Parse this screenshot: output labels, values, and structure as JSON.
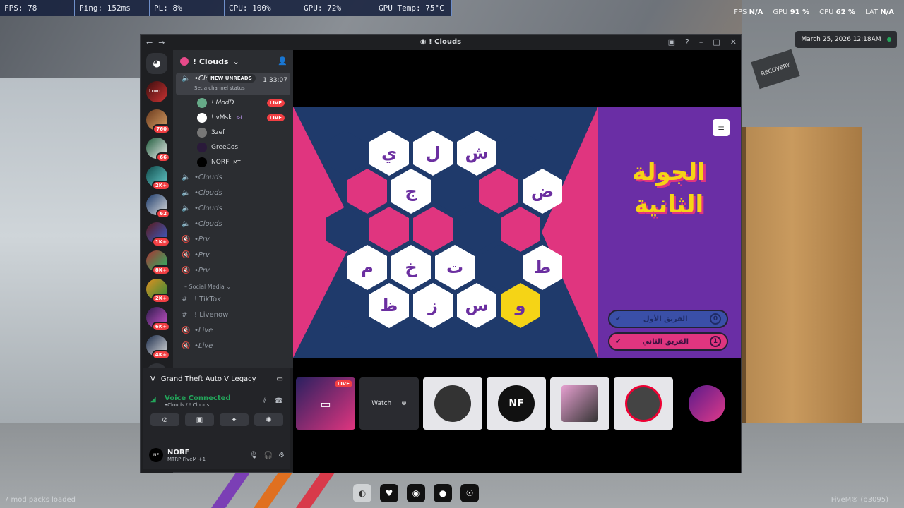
{
  "perf": [
    "FPS: 78",
    "Ping: 152ms",
    "PL: 8%",
    "CPU: 100%",
    "GPU: 72%",
    "GPU Temp: 75°C"
  ],
  "overlay_stats": [
    {
      "label": "FPS",
      "value": "N/A"
    },
    {
      "label": "GPU",
      "value": "91 %"
    },
    {
      "label": "CPU",
      "value": "62 %"
    },
    {
      "label": "LAT",
      "value": "N/A"
    }
  ],
  "clock": "March 25, 2026 12:18AM",
  "bg_sign": "RECOVERY",
  "bottom_left": "7 mod packs loaded",
  "bottom_right": "FiveM® (b3095)",
  "window": {
    "title": "! Clouds"
  },
  "guilds": [
    {
      "label": "Loxo",
      "badge": ""
    },
    {
      "label": "",
      "badge": "760"
    },
    {
      "label": "",
      "badge": "66"
    },
    {
      "label": "",
      "badge": "2K+"
    },
    {
      "label": "",
      "badge": "62"
    },
    {
      "label": "",
      "badge": "1K+"
    },
    {
      "label": "",
      "badge": "8K+"
    },
    {
      "label": "",
      "badge": "2K+"
    },
    {
      "label": "",
      "badge": "6K+"
    },
    {
      "label": "",
      "badge": "4K+"
    }
  ],
  "server": {
    "name": "! Clouds"
  },
  "active_channel": {
    "name": "•Clouds",
    "status": "Set a channel status",
    "time": "1:33:07",
    "unreads": "NEW UNREADS"
  },
  "voice_users": [
    {
      "name": "! ModD",
      "live": "LIVE"
    },
    {
      "name": "! vMsk",
      "tag": "s-i",
      "live": "LIVE"
    },
    {
      "name": "3zef",
      "live": ""
    },
    {
      "name": "GreeCos",
      "live": ""
    },
    {
      "name": "NORF",
      "tag": "MT",
      "live": ""
    }
  ],
  "channels": [
    "•Clouds",
    "•Clouds",
    "•Clouds",
    "•Clouds",
    "•Prv",
    "•Prv",
    "•Prv"
  ],
  "category": "Social Media",
  "text_channels": [
    "! TikTok",
    "! Livenow"
  ],
  "more_channels": [
    "•Live",
    "•Live"
  ],
  "game_activity": "Grand Theft Auto V Legacy",
  "voice": {
    "status": "Voice Connected",
    "location": "•Clouds / ! Clouds"
  },
  "me": {
    "name": "NORF",
    "status": "MTRP FiveM +1"
  },
  "board": {
    "round_title": "الجولة الثانية",
    "team_one": {
      "name": "الفريق الأول",
      "score": "0"
    },
    "team_two": {
      "name": "الفريق الثاني",
      "score": "1"
    }
  },
  "hexes": [
    {
      "l": "",
      "c": "navy"
    },
    {
      "l": "ي",
      "c": "white"
    },
    {
      "l": "ل",
      "c": "white"
    },
    {
      "l": "ش",
      "c": "white"
    },
    {
      "l": "",
      "c": "navy"
    },
    {
      "l": "",
      "c": "pink"
    },
    {
      "l": "ج",
      "c": "white"
    },
    {
      "l": "",
      "c": "navy"
    },
    {
      "l": "",
      "c": "pink"
    },
    {
      "l": "ض",
      "c": "white"
    },
    {
      "l": "",
      "c": "navy"
    },
    {
      "l": "",
      "c": "pink"
    },
    {
      "l": "",
      "c": "pink"
    },
    {
      "l": "",
      "c": "navy"
    },
    {
      "l": "",
      "c": "pink"
    },
    {
      "l": "م",
      "c": "white"
    },
    {
      "l": "خ",
      "c": "white"
    },
    {
      "l": "ت",
      "c": "white"
    },
    {
      "l": "",
      "c": "navy"
    },
    {
      "l": "ط",
      "c": "white"
    },
    {
      "l": "",
      "c": "navy"
    },
    {
      "l": "ظ",
      "c": "white"
    },
    {
      "l": "ز",
      "c": "white"
    },
    {
      "l": "س",
      "c": "white"
    },
    {
      "l": "و",
      "c": "yellow"
    }
  ],
  "thumbs": [
    {
      "label": "",
      "live": "LIVE",
      "type": "dark"
    },
    {
      "label": "Watch",
      "live": "",
      "type": "dark"
    },
    {
      "label": "",
      "live": "",
      "type": "light"
    },
    {
      "label": "NF",
      "live": "",
      "type": "light"
    },
    {
      "label": "",
      "live": "",
      "type": "light"
    },
    {
      "label": "",
      "live": "",
      "type": "light"
    },
    {
      "label": "",
      "live": "",
      "type": "dark"
    }
  ]
}
